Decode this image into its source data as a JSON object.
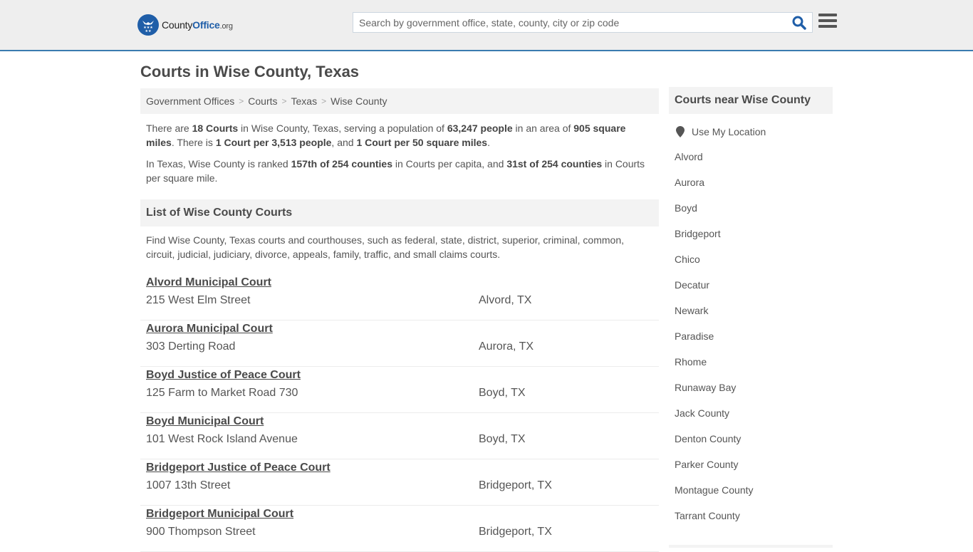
{
  "header": {
    "logo": {
      "part1": "County",
      "part2": "Office",
      "part3": ".org"
    },
    "search": {
      "placeholder": "Search by government office, state, county, city or zip code",
      "value": ""
    },
    "icons": {
      "logo": "eagle-stars-badge",
      "search": "search-icon",
      "menu": "hamburger-menu-icon"
    }
  },
  "page": {
    "title": "Courts in Wise County, Texas"
  },
  "breadcrumb": [
    {
      "label": "Government Offices"
    },
    {
      "label": "Courts"
    },
    {
      "label": "Texas"
    },
    {
      "label": "Wise County"
    }
  ],
  "summary": {
    "p1": {
      "t1": "There are ",
      "b1": "18 Courts",
      "t2": " in Wise County, Texas, serving a population of ",
      "b2": "63,247 people",
      "t3": " in an area of ",
      "b3": "905 square miles",
      "t4": ". There is ",
      "b4": "1 Court per 3,513 people",
      "t5": ", and ",
      "b5": "1 Court per 50 square miles",
      "t6": "."
    },
    "p2": {
      "t1": "In Texas, Wise County is ranked ",
      "b1": "157th of 254 counties",
      "t2": " in Courts per capita, and ",
      "b2": "31st of 254 counties",
      "t3": " in Courts per square mile."
    }
  },
  "list": {
    "heading": "List of Wise County Courts",
    "description": "Find Wise County, Texas courts and courthouses, such as federal, state, district, superior, criminal, common, circuit, judicial, judiciary, divorce, appeals, family, traffic, and small claims courts.",
    "courts": [
      {
        "name": "Alvord Municipal Court",
        "address": "215 West Elm Street",
        "city": "Alvord, TX"
      },
      {
        "name": "Aurora Municipal Court",
        "address": "303 Derting Road",
        "city": "Aurora, TX"
      },
      {
        "name": "Boyd Justice of Peace Court",
        "address": "125 Farm to Market Road 730",
        "city": "Boyd, TX"
      },
      {
        "name": "Boyd Municipal Court",
        "address": "101 West Rock Island Avenue",
        "city": "Boyd, TX"
      },
      {
        "name": "Bridgeport Justice of Peace Court",
        "address": "1007 13th Street",
        "city": "Bridgeport, TX"
      },
      {
        "name": "Bridgeport Municipal Court",
        "address": "900 Thompson Street",
        "city": "Bridgeport, TX"
      }
    ]
  },
  "sidebar": {
    "heading": "Courts near Wise County",
    "use_location": "Use My Location",
    "links": [
      "Alvord",
      "Aurora",
      "Boyd",
      "Bridgeport",
      "Chico",
      "Decatur",
      "Newark",
      "Paradise",
      "Rhome",
      "Runaway Bay",
      "Jack County",
      "Denton County",
      "Parker County",
      "Montague County",
      "Tarrant County"
    ]
  },
  "colors": {
    "brand": "#1f5ea8",
    "header_bg": "#eeeeee",
    "accent_line": "#3a7bb0",
    "panel_bg": "#f3f3f3",
    "text": "#555555"
  }
}
